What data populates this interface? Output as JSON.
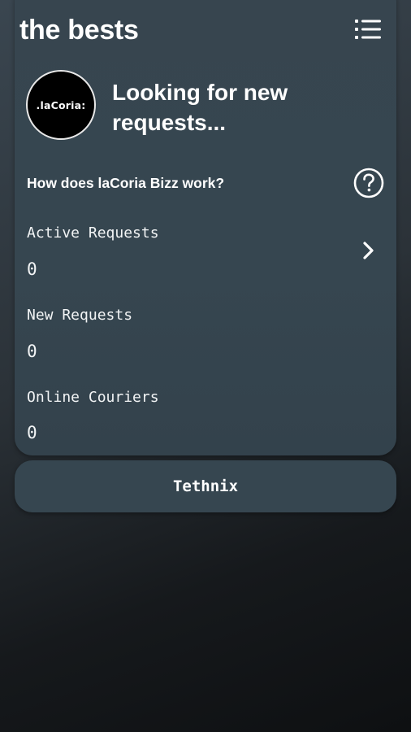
{
  "header": {
    "title": "the bests",
    "menu_icon": "list-menu-icon"
  },
  "profile": {
    "avatar_text": ".laCoria:",
    "status": "Looking for new requests..."
  },
  "help": {
    "question": "How does laCoria Bizz work?",
    "icon": "question-circle-icon"
  },
  "stats": [
    {
      "label": "Active Requests",
      "value": "0"
    },
    {
      "label": "New Requests",
      "value": "0"
    },
    {
      "label": "Online Couriers",
      "value": "0"
    }
  ],
  "active_requests_chevron": "chevron-right-icon",
  "footer": {
    "button_label": "Tethnix"
  },
  "colors": {
    "background_top": "#3a4650",
    "background_bottom": "#0e1012",
    "card": "#364650",
    "text": "#ffffff"
  }
}
